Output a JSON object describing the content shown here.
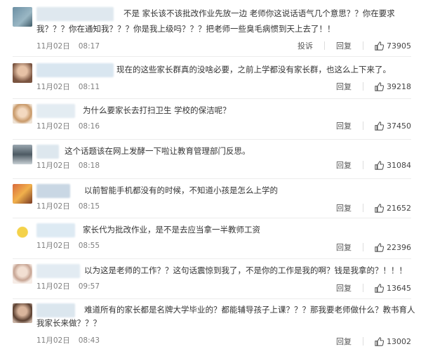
{
  "comments": [
    {
      "text_line1": "不是 家长该不该批改作业先放一边 老师你这说话语气几个意思？？你在要求",
      "text_line2": "我？？？你在通知我？？？你是我上级吗？？？把老师一些臭毛病惯到天上去了！！",
      "date": "11月02日",
      "time": "08:17",
      "report_label": "投诉",
      "reply_label": "回复",
      "likes": "73905",
      "avatar_color": "#6b8fa3",
      "name_color": "#dfe8ef"
    },
    {
      "text_line1": "现在的这些家长群真的没啥必要，之前上学都没有家长群，也这么上下来了。",
      "date": "11月02日",
      "time": "08:11",
      "reply_label": "回复",
      "likes": "39218",
      "avatar_color": "#b48a6e",
      "name_color": "#d9e6f0"
    },
    {
      "text_line1": "为什么要家长去打扫卫生 学校的保洁呢？",
      "date": "11月02日",
      "time": "08:16",
      "reply_label": "回复",
      "likes": "37450",
      "avatar_color": "#d9b38c",
      "name_color": "#e3ecf2"
    },
    {
      "text_line1": "这个话题该在网上发酵一下啦让教育管理部门反思。",
      "date": "11月02日",
      "time": "08:18",
      "reply_label": "回复",
      "likes": "31084",
      "avatar_color": "#5f6f7a",
      "name_color": "#dde7ee"
    },
    {
      "text_line1": "以前智能手机都没有的时候，不知道小孩是怎么上学的",
      "date": "11月02日",
      "time": "08:15",
      "reply_label": "回复",
      "likes": "21652",
      "avatar_color": "#c0623f",
      "name_color": "#c9d7e4"
    },
    {
      "text_line1": "家长代为批改作业，是不是去应当拿一半教师工资",
      "date": "11月02日",
      "time": "08:55",
      "reply_label": "回复",
      "likes": "22396",
      "avatar_color": "#e8c64a",
      "name_color": "#ddeaf3"
    },
    {
      "text_line1": "以为这是老师的工作？？这句话震惊到我了，不是你的工作是我的啊？钱是我拿的？！！！",
      "date": "11月02日",
      "time": "09:57",
      "reply_label": "回复",
      "likes": "13645",
      "avatar_color": "#e6cfc0",
      "name_color": "#e2ebf2"
    },
    {
      "text_line1": "难道所有的家长都是名牌大学毕业的？都能辅导孩子上课？？？那我要老师做什么？教书育人",
      "text_line2": "我家长来做？？？",
      "date": "11月02日",
      "time": "08:43",
      "reply_label": "回复",
      "likes": "13002",
      "avatar_color": "#8a6a55",
      "name_color": "#dbe6ee"
    }
  ]
}
